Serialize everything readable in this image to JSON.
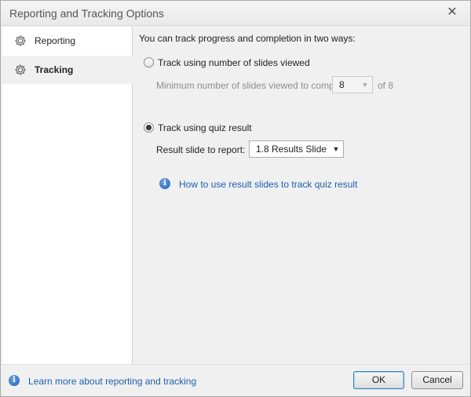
{
  "window": {
    "title": "Reporting and Tracking Options",
    "close_glyph": "✕"
  },
  "sidebar": {
    "items": [
      {
        "label": "Reporting",
        "icon": "gear-icon",
        "selected": false
      },
      {
        "label": "Tracking",
        "icon": "gear-icon",
        "selected": true
      }
    ]
  },
  "tracking": {
    "intro": "You can track progress and completion in two ways:",
    "option_slides": {
      "label": "Track using number of slides viewed",
      "selected": false,
      "min_label": "Minimum number of slides viewed to complete:",
      "min_value": "8",
      "of_total": "of 8"
    },
    "option_quiz": {
      "label": "Track using quiz result",
      "selected": true,
      "result_label": "Result slide to report:",
      "result_value": "1.8 Results Slide"
    },
    "help_link": "How to use result slides to track quiz result"
  },
  "footer": {
    "learn_link": "Learn more about reporting and tracking",
    "ok_label": "OK",
    "cancel_label": "Cancel"
  },
  "colors": {
    "link": "#1c5fb0",
    "accent_border": "#3c7fb1"
  }
}
